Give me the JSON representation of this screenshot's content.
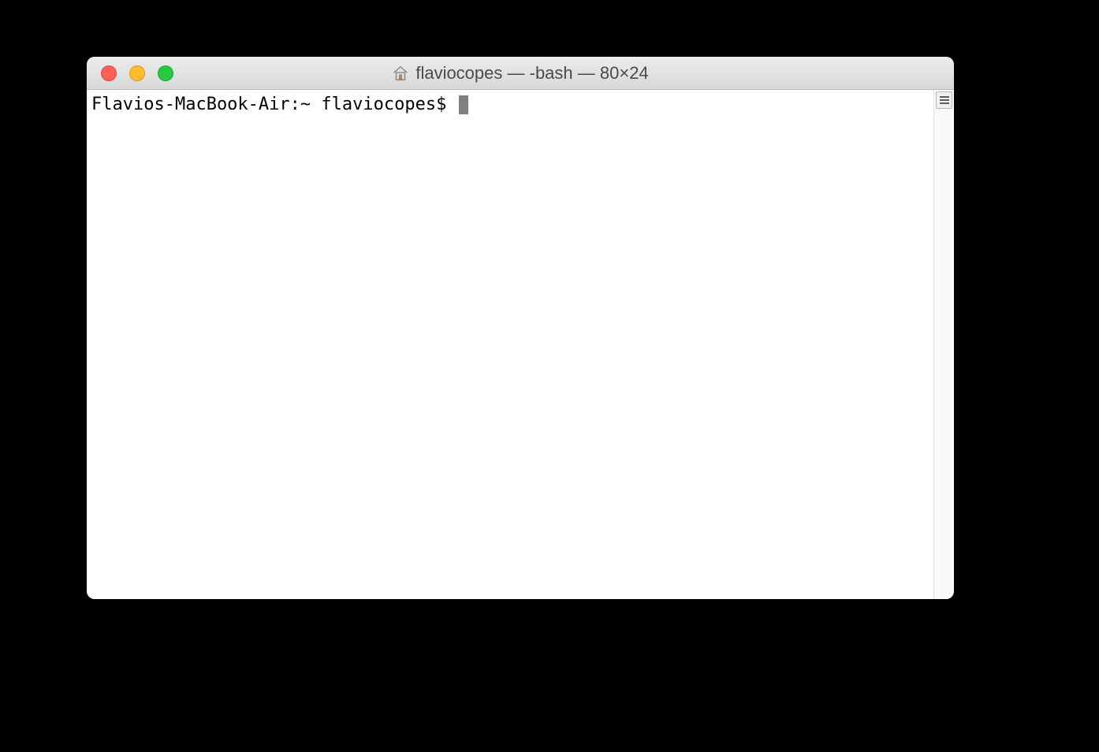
{
  "window": {
    "title": "flaviocopes — -bash — 80×24"
  },
  "terminal": {
    "prompt": "Flavios-MacBook-Air:~ flaviocopes$ "
  }
}
